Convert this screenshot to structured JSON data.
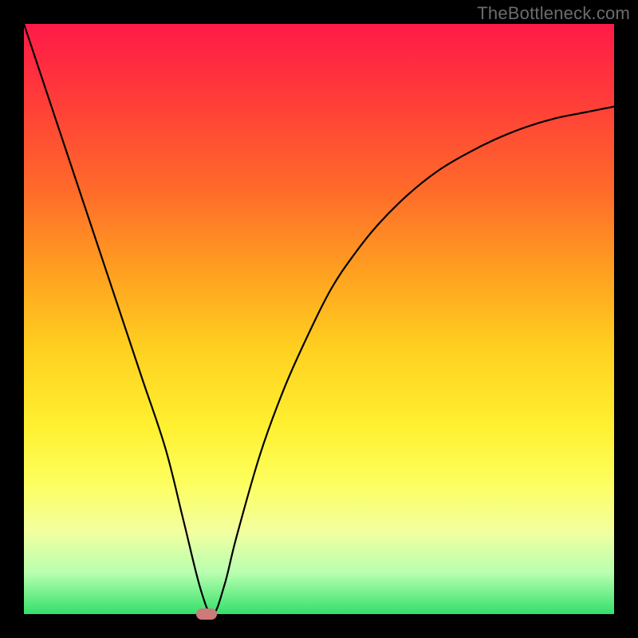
{
  "watermark": "TheBottleneck.com",
  "chart_data": {
    "type": "line",
    "title": "",
    "xlabel": "",
    "ylabel": "",
    "xlim": [
      0,
      100
    ],
    "ylim": [
      0,
      100
    ],
    "background_gradient": {
      "top": "#ff1a48",
      "mid": "#ffd020",
      "bottom": "#33e06a"
    },
    "series": [
      {
        "name": "curve",
        "type": "line",
        "color": "#000000",
        "x": [
          0,
          4,
          8,
          12,
          16,
          20,
          24,
          27,
          30,
          32,
          34,
          36,
          40,
          44,
          48,
          52,
          56,
          60,
          65,
          70,
          75,
          80,
          85,
          90,
          95,
          100
        ],
        "y": [
          100,
          88,
          76,
          64,
          52,
          40,
          28,
          16,
          4,
          0,
          5,
          13,
          27,
          38,
          47,
          55,
          61,
          66,
          71,
          75,
          78,
          80.5,
          82.5,
          84,
          85,
          86
        ]
      }
    ],
    "marker": {
      "x": 31,
      "y": 0,
      "color": "#cc7a7a"
    },
    "grid": false,
    "legend": false
  }
}
